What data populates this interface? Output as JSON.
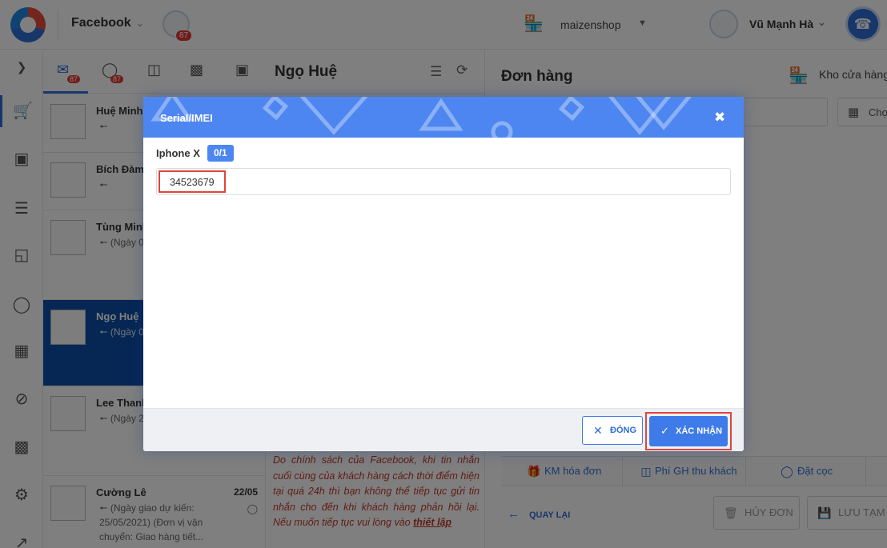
{
  "topbar": {
    "channel": "Facebook",
    "page_badge": "87",
    "shop_name": "maizenshop",
    "user_name": "Vũ Mạnh Hà"
  },
  "conv_tabs": {
    "badge_a": "87",
    "badge_b": "87"
  },
  "conversations": [
    {
      "name": "Huệ Minh",
      "snippet": "",
      "date": ""
    },
    {
      "name": "Bích Đàm",
      "snippet": "",
      "date": ""
    },
    {
      "name": "Tùng Minh",
      "snippet": "(Ngày 06/06 chuyể",
      "date": ""
    },
    {
      "name": "Ngọ Huệ",
      "snippet": "(Ngày 03/06 chuyể",
      "date": ""
    },
    {
      "name": "Lee Thanh",
      "snippet": "(Ngày 28/05 chuyể",
      "date": ""
    },
    {
      "name": "Cường Lê",
      "snippet": "(Ngày giao dự kiến: 25/05/2021) (Đơn vị vận chuyển: Giao hàng tiết...",
      "date": "22/05"
    }
  ],
  "chat": {
    "title": "Ngọ Huệ",
    "policy_text": "Do chính sách của Facebook, khi tin nhắn cuối cùng của khách hàng cách thời điểm hiện tại quá 24h thì bạn không thể tiếp tục gửi tin nhắn cho đến khi khách hàng phản hồi lại. Nếu muốn tiếp tục vui lòng vào",
    "policy_link": "thiết lập"
  },
  "order": {
    "title": "Đơn hàng",
    "warehouse": "Kho cửa hàng",
    "pick_label": "Chọ",
    "footer_tabs": [
      "KM hóa đơn",
      "Phí GH thu khách",
      "Đặt cọc"
    ],
    "back_label": "QUAY LẠI",
    "cancel_label": "HỦY ĐƠN",
    "save_draft_label": "LƯU TẠM"
  },
  "modal": {
    "title": "Serial/IMEI",
    "product_name": "Iphone X",
    "quantity": "0/1",
    "serial_value": "34523679",
    "close_label": "ĐÓNG",
    "confirm_label": "XÁC NHẬN"
  },
  "colors": {
    "primary": "#4d86f0",
    "active_conv": "#0d4ea6",
    "highlight_red": "#e0443b",
    "policy_red": "#c0392b"
  }
}
